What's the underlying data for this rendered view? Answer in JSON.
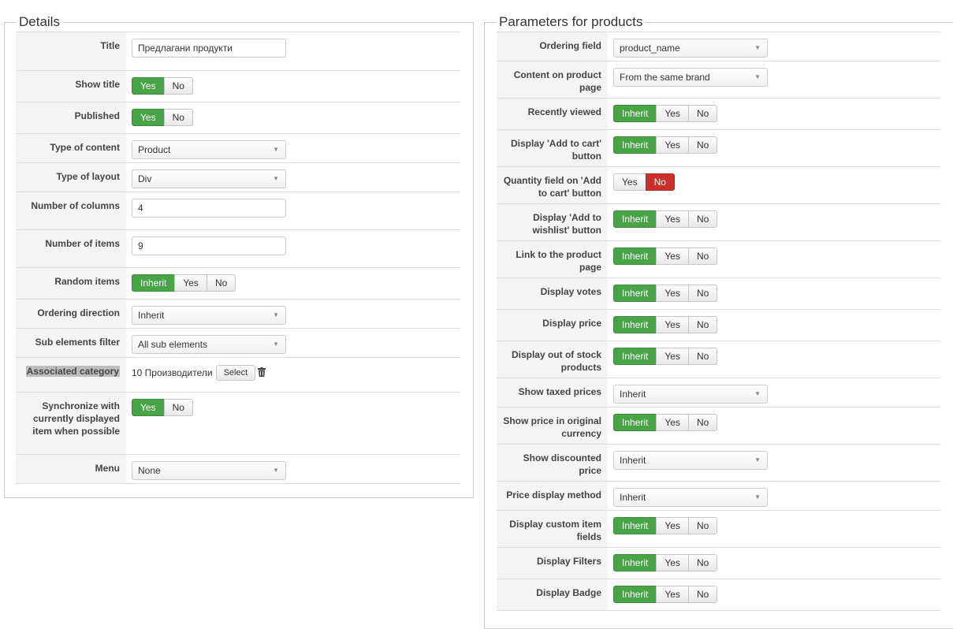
{
  "details": {
    "legend": "Details",
    "title": {
      "label": "Title",
      "value": "Предлагани продукти"
    },
    "show_title": {
      "label": "Show title",
      "yes": "Yes",
      "no": "No"
    },
    "published": {
      "label": "Published",
      "yes": "Yes",
      "no": "No"
    },
    "type_of_content": {
      "label": "Type of content",
      "value": "Product"
    },
    "type_of_layout": {
      "label": "Type of layout",
      "value": "Div"
    },
    "number_of_columns": {
      "label": "Number of columns",
      "value": "4"
    },
    "number_of_items": {
      "label": "Number of items",
      "value": "9"
    },
    "random_items": {
      "label": "Random items",
      "inherit": "Inherit",
      "yes": "Yes",
      "no": "No"
    },
    "ordering_direction": {
      "label": "Ordering direction",
      "value": "Inherit"
    },
    "sub_elements_filter": {
      "label": "Sub elements filter",
      "value": "All sub elements"
    },
    "associated_category": {
      "label": "Associated category",
      "value": "10 Производители",
      "button": "Select"
    },
    "synchronize": {
      "label": "Synchronize with currently displayed item when possible",
      "yes": "Yes",
      "no": "No"
    },
    "menu": {
      "label": "Menu",
      "value": "None"
    }
  },
  "params": {
    "legend": "Parameters for products",
    "ordering_field": {
      "label": "Ordering field",
      "value": "product_name"
    },
    "content_on_product_page": {
      "label": "Content on product page",
      "value": "From the same brand"
    },
    "recently_viewed": {
      "label": "Recently viewed",
      "inherit": "Inherit",
      "yes": "Yes",
      "no": "No"
    },
    "display_add_to_cart": {
      "label": "Display 'Add to cart' button",
      "inherit": "Inherit",
      "yes": "Yes",
      "no": "No"
    },
    "quantity_field": {
      "label": "Quantity field on 'Add to cart' button",
      "yes": "Yes",
      "no": "No"
    },
    "display_add_to_wishlist": {
      "label": "Display 'Add to wishlist' button",
      "inherit": "Inherit",
      "yes": "Yes",
      "no": "No"
    },
    "link_to_product_page": {
      "label": "Link to the product page",
      "inherit": "Inherit",
      "yes": "Yes",
      "no": "No"
    },
    "display_votes": {
      "label": "Display votes",
      "inherit": "Inherit",
      "yes": "Yes",
      "no": "No"
    },
    "display_price": {
      "label": "Display price",
      "inherit": "Inherit",
      "yes": "Yes",
      "no": "No"
    },
    "display_out_of_stock": {
      "label": "Display out of stock products",
      "inherit": "Inherit",
      "yes": "Yes",
      "no": "No"
    },
    "show_taxed_prices": {
      "label": "Show taxed prices",
      "value": "Inherit"
    },
    "show_price_original_currency": {
      "label": "Show price in original currency",
      "inherit": "Inherit",
      "yes": "Yes",
      "no": "No"
    },
    "show_discounted_price": {
      "label": "Show discounted price",
      "value": "Inherit"
    },
    "price_display_method": {
      "label": "Price display method",
      "value": "Inherit"
    },
    "display_custom_fields": {
      "label": "Display custom item fields",
      "inherit": "Inherit",
      "yes": "Yes",
      "no": "No"
    },
    "display_filters": {
      "label": "Display Filters",
      "inherit": "Inherit",
      "yes": "Yes",
      "no": "No"
    },
    "display_badge": {
      "label": "Display Badge",
      "inherit": "Inherit",
      "yes": "Yes",
      "no": "No"
    }
  },
  "colors": {
    "active_green": "#47a447",
    "active_red": "#c9302c"
  },
  "icons": {
    "select_caret": "chevron-down-icon",
    "remove": "trash-icon"
  }
}
